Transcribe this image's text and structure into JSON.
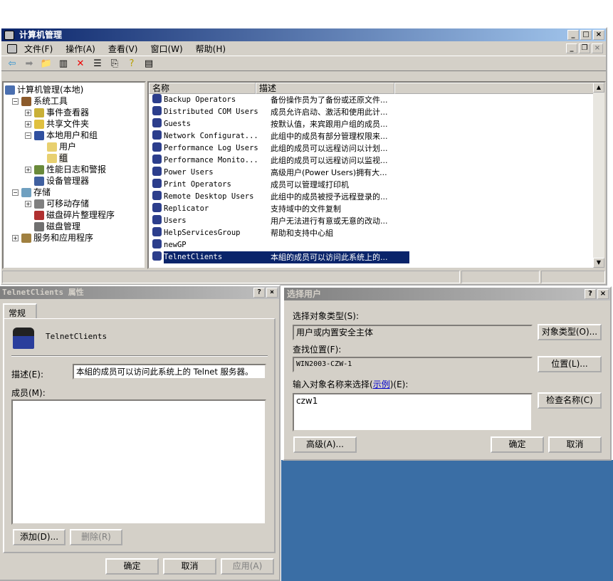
{
  "main_window": {
    "title": "计算机管理",
    "menu": [
      "文件(F)",
      "操作(A)",
      "查看(V)",
      "窗口(W)",
      "帮助(H)"
    ],
    "toolbar_icons": [
      "back-icon",
      "forward-icon",
      "up-folder-icon",
      "show-hide-tree-icon",
      "delete-icon",
      "properties-icon",
      "export-icon",
      "help-icon",
      "action-pane-icon"
    ],
    "tree": [
      {
        "label": "计算机管理(本地)",
        "level": 0
      },
      {
        "label": "系统工具",
        "level": 1,
        "expander": "−"
      },
      {
        "label": "事件查看器",
        "level": 2,
        "expander": "+"
      },
      {
        "label": "共享文件夹",
        "level": 2,
        "expander": "+"
      },
      {
        "label": "本地用户和组",
        "level": 2,
        "expander": "−"
      },
      {
        "label": "用户",
        "level": 3
      },
      {
        "label": "组",
        "level": 3,
        "selected": true
      },
      {
        "label": "性能日志和警报",
        "level": 2,
        "expander": "+"
      },
      {
        "label": "设备管理器",
        "level": 2
      },
      {
        "label": "存储",
        "level": 1,
        "expander": "−"
      },
      {
        "label": "可移动存储",
        "level": 2,
        "expander": "+"
      },
      {
        "label": "磁盘碎片整理程序",
        "level": 2
      },
      {
        "label": "磁盘管理",
        "level": 2
      },
      {
        "label": "服务和应用程序",
        "level": 1,
        "expander": "+"
      }
    ],
    "columns": [
      "名称",
      "描述"
    ],
    "groups": [
      {
        "name": "Backup Operators",
        "desc": "备份操作员为了备份或还原文件..."
      },
      {
        "name": "Distributed COM Users",
        "desc": "成员允许启动、激活和使用此计..."
      },
      {
        "name": "Guests",
        "desc": "按默认值，来宾跟用户组的成员..."
      },
      {
        "name": "Network Configurat...",
        "desc": "此组中的成员有部分管理权限来..."
      },
      {
        "name": "Performance Log Users",
        "desc": "此组的成员可以远程访问以计划..."
      },
      {
        "name": "Performance Monito...",
        "desc": "此组的成员可以远程访问以监视..."
      },
      {
        "name": "Power Users",
        "desc": "高级用户(Power Users)拥有大..."
      },
      {
        "name": "Print Operators",
        "desc": "成员可以管理域打印机"
      },
      {
        "name": "Remote Desktop Users",
        "desc": "此组中的成员被授予远程登录的..."
      },
      {
        "name": "Replicator",
        "desc": "支持域中的文件复制"
      },
      {
        "name": "Users",
        "desc": "用户无法进行有意或无意的改动..."
      },
      {
        "name": "HelpServicesGroup",
        "desc": "帮助和支持中心組"
      },
      {
        "name": "newGP",
        "desc": ""
      },
      {
        "name": "TelnetClients",
        "desc": "本組的成员可以访问此系统上的...",
        "selected": true
      }
    ]
  },
  "props_dialog": {
    "title": "TelnetClients 属性",
    "tab": "常规",
    "group_name": "TelnetClients",
    "desc_label": "描述(E):",
    "desc_value": "本組的成员可以访问此系统上的 Telnet 服务器。",
    "members_label": "成员(M):",
    "add": "添加(D)...",
    "remove": "删除(R)",
    "ok": "确定",
    "cancel": "取消",
    "apply": "应用(A)"
  },
  "select_dialog": {
    "title": "选择用户",
    "type_label": "选择对象类型(S):",
    "type_value": "用户或内置安全主体",
    "type_btn": "对象类型(O)...",
    "loc_label": "查找位置(F):",
    "loc_value": "WIN2003-CZW-1",
    "loc_btn": "位置(L)...",
    "names_label": "输入对象名称来选择(",
    "examples_link": "示例",
    "names_label_end": ")(E):",
    "names_value": "czw1",
    "check_btn": "检查名称(C)",
    "advanced": "高级(A)...",
    "ok": "确定",
    "cancel": "取消"
  },
  "colors": {
    "title_active": "#0a246a",
    "desktop": "#3a6ea5",
    "face": "#d4d0c8"
  }
}
